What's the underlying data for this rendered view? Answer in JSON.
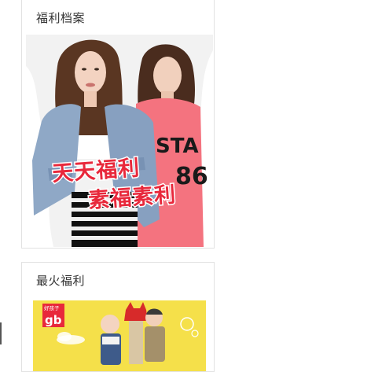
{
  "sections": [
    {
      "title": "福利档案",
      "banner": {
        "overlay_line1": "天天福利",
        "overlay_line2": "素福素利",
        "shirt_text_1": "STA",
        "shirt_text_2": "86"
      }
    },
    {
      "title": "最火福利",
      "banner": {
        "brand_small": "好孩子",
        "brand_big": "gb"
      }
    }
  ],
  "colors": {
    "brand_red": "#e8283b",
    "pink_shirt": "#f4737f",
    "denim": "#8fa8c6",
    "banner2_bg": "#f5e04a"
  }
}
